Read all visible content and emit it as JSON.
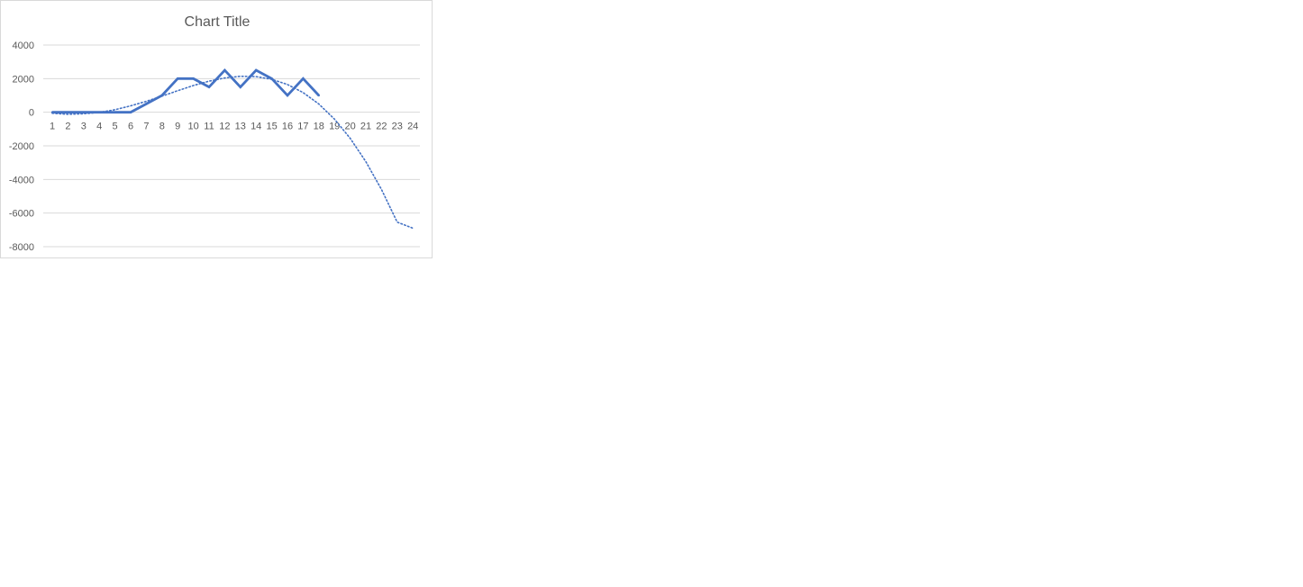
{
  "chart_data": {
    "type": "line",
    "title": "Chart Title",
    "x_labels": [
      "1",
      "2",
      "3",
      "4",
      "5",
      "6",
      "7",
      "8",
      "9",
      "10",
      "11",
      "12",
      "13",
      "14",
      "15",
      "16",
      "17",
      "18",
      "19",
      "20",
      "21",
      "22",
      "23",
      "24"
    ],
    "y_ticks": [
      4000,
      2000,
      0,
      -2000,
      -4000,
      -6000,
      -8000
    ],
    "ylim": [
      -8000,
      4000
    ],
    "grid": true,
    "series": [
      {
        "values": [
          0,
          0,
          0,
          0,
          0,
          0,
          500,
          1000,
          2000,
          2000,
          1500,
          2500,
          1500,
          2500,
          2000,
          1000,
          2000,
          1000
        ],
        "color": "#4472C4",
        "style": "solid"
      }
    ],
    "trendline": {
      "type": "polynomial",
      "style": "dotted",
      "color": "#4472C4",
      "values": [
        -60,
        -120,
        -90,
        -10,
        150,
        380,
        650,
        960,
        1280,
        1590,
        1850,
        2040,
        2140,
        2120,
        1960,
        1650,
        1170,
        490,
        -410,
        -1550,
        -2940,
        -4600,
        -6540,
        -6900
      ]
    }
  }
}
